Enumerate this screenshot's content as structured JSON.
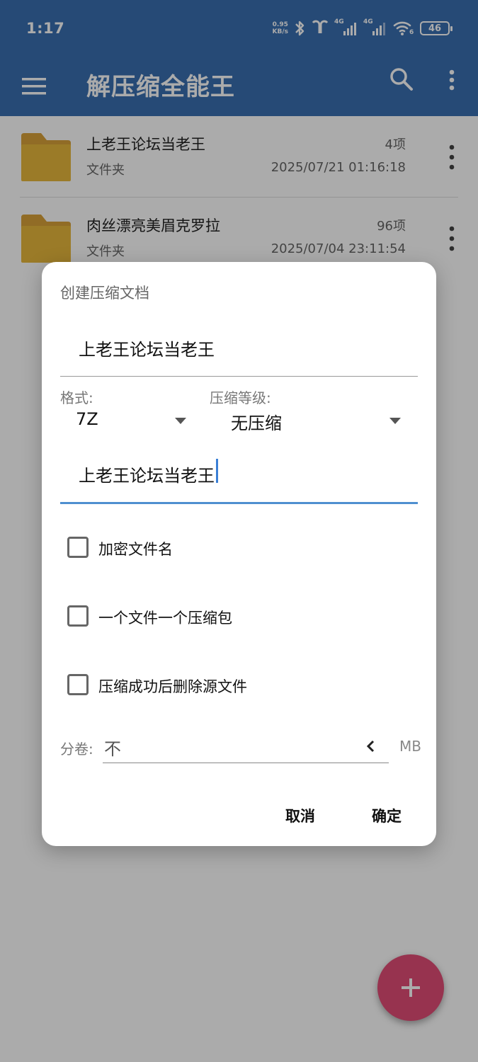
{
  "status_bar": {
    "time": "1:17",
    "net_speed_value": "0.95",
    "net_speed_unit": "KB/s",
    "signal_1_label": "4G",
    "signal_2_label": "4G",
    "wifi_label": "6",
    "battery": "46"
  },
  "app_bar": {
    "title": "解压缩全能王"
  },
  "files": [
    {
      "name": "上老王论坛当老王",
      "type": "文件夹",
      "count": "4项",
      "date": "2025/07/21 01:16:18"
    },
    {
      "name": "肉丝漂亮美眉克罗拉",
      "type": "文件夹",
      "count": "96项",
      "date": "2025/07/04 23:11:54"
    }
  ],
  "dialog": {
    "title": "创建压缩文档",
    "archive_name": "上老王论坛当老王",
    "format_label": "格式:",
    "format_value": "7Z",
    "level_label": "压缩等级:",
    "level_value": "无压缩",
    "password_value": "上老王论坛当老王",
    "options": [
      {
        "label": "加密文件名",
        "checked": false
      },
      {
        "label": "一个文件一个压缩包",
        "checked": false
      },
      {
        "label": "压缩成功后删除源文件",
        "checked": false
      }
    ],
    "split_label": "分卷:",
    "split_value": "不",
    "split_unit": "MB",
    "cancel_label": "取消",
    "ok_label": "确定"
  },
  "colors": {
    "primary": "#3a6fb0",
    "accent": "#e24d76",
    "folder": "#e8b83c",
    "focus_underline": "#4f8fd0"
  }
}
